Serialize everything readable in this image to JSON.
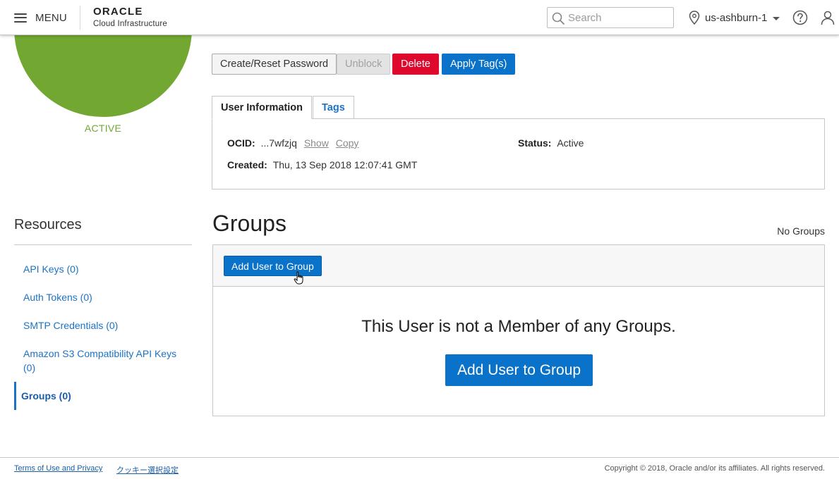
{
  "header": {
    "menu_label": "MENU",
    "logo_main": "ORACLE",
    "logo_sub": "Cloud Infrastructure",
    "search_placeholder": "Search",
    "region": "us-ashburn-1"
  },
  "user_status": {
    "status_label": "ACTIVE",
    "status_color": "#72a832"
  },
  "actions": {
    "create_reset_password": "Create/Reset Password",
    "unblock": "Unblock",
    "delete": "Delete",
    "apply_tags": "Apply Tag(s)"
  },
  "tabs": {
    "user_information": "User Information",
    "tags": "Tags"
  },
  "user_info": {
    "ocid_label": "OCID:",
    "ocid_value": "...7wfzjq",
    "show_link": "Show",
    "copy_link": "Copy",
    "status_label": "Status:",
    "status_value": "Active",
    "created_label": "Created:",
    "created_value": "Thu, 13 Sep 2018 12:07:41 GMT"
  },
  "resources": {
    "title": "Resources",
    "items": [
      {
        "label": "API Keys (0)",
        "active": false
      },
      {
        "label": "Auth Tokens (0)",
        "active": false
      },
      {
        "label": "SMTP Credentials (0)",
        "active": false
      },
      {
        "label": "Amazon S3 Compatibility API Keys (0)",
        "active": false
      },
      {
        "label": "Groups (0)",
        "active": true
      }
    ]
  },
  "groups": {
    "title": "Groups",
    "count_label": "No Groups",
    "toolbar_button": "Add User to Group",
    "empty_message": "This User is not a Member of any Groups.",
    "empty_button": "Add User to Group"
  },
  "footer": {
    "terms_link": "Terms of Use and Privacy",
    "cookie_link": "クッキー選択設定",
    "copyright": "Copyright © 2018, Oracle and/or its affiliates. All rights reserved."
  },
  "colors": {
    "primary": "#0a72c8",
    "danger": "#e0072d",
    "link": "#1a73c7",
    "active_green": "#72a832"
  },
  "icons": [
    "hamburger-icon",
    "search-icon",
    "location-pin-icon",
    "caret-down-icon",
    "help-icon",
    "user-icon",
    "hand-cursor-icon"
  ]
}
